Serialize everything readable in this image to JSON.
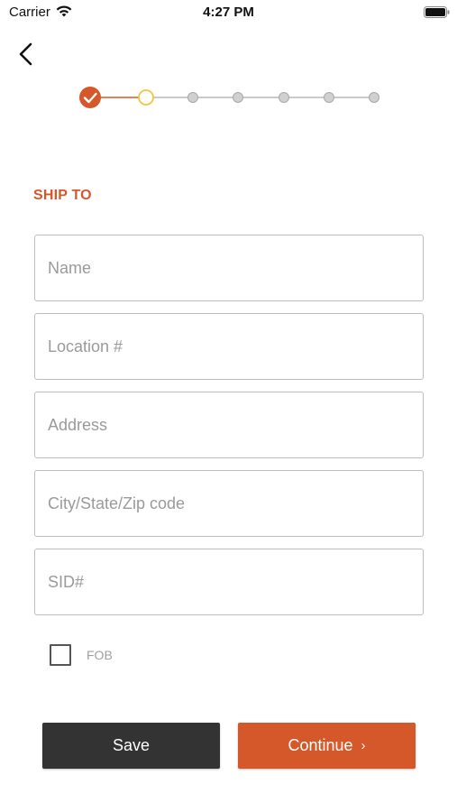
{
  "status_bar": {
    "carrier": "Carrier",
    "time": "4:27 PM",
    "wifi_icon": "wifi-icon",
    "battery_icon": "battery-icon"
  },
  "nav": {
    "back_icon": "chevron-left-icon"
  },
  "progress": {
    "total_steps": 7,
    "completed_steps": 1,
    "current_step": 2,
    "colors": {
      "completed": "#d4582a",
      "current": "#f2c53d",
      "pending": "#cfcfcf"
    }
  },
  "form": {
    "section_title": "SHIP TO",
    "fields": {
      "name": {
        "placeholder": "Name",
        "value": ""
      },
      "location": {
        "placeholder": "Location #",
        "value": ""
      },
      "address": {
        "placeholder": "Address",
        "value": ""
      },
      "city_state_zip": {
        "placeholder": "City/State/Zip code",
        "value": ""
      },
      "sid": {
        "placeholder": "SID#",
        "value": ""
      }
    },
    "fob": {
      "label": "FOB",
      "checked": false
    }
  },
  "actions": {
    "save_label": "Save",
    "continue_label": "Continue",
    "continue_icon": "chevron-right-icon"
  },
  "colors": {
    "accent": "#d4582a",
    "dark_button": "#333333"
  }
}
